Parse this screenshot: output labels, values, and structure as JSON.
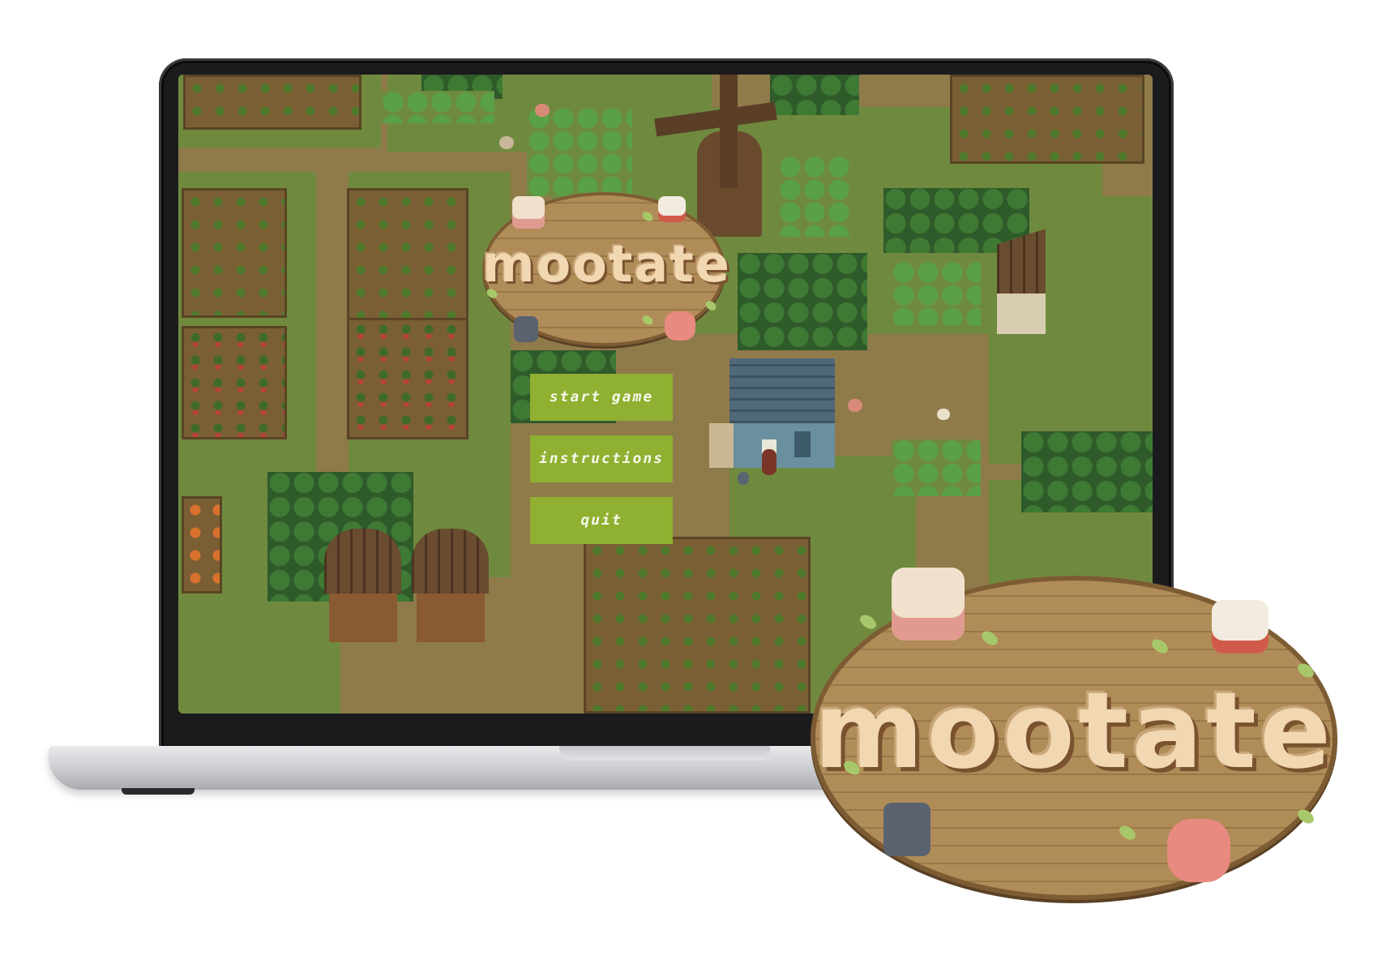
{
  "game": {
    "title": "mootate"
  },
  "menu": {
    "start_label": "start game",
    "instructions_label": "instructions",
    "quit_label": "quit"
  },
  "overlay": {
    "logo_text": "mootate"
  },
  "colors": {
    "button_bg": "#8fb030",
    "button_text": "#f6f8ea",
    "sign_wood": "#a88450",
    "title_text": "#f1d7b2",
    "grass": "#6f8a3e",
    "path": "#8f7a4a"
  }
}
